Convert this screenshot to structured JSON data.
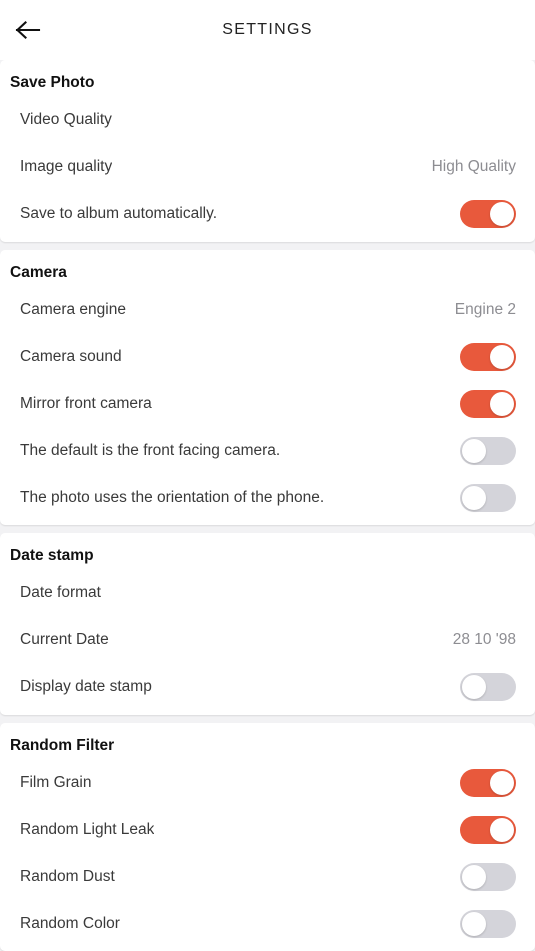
{
  "header": {
    "title": "SETTINGS",
    "back_icon": "arrow-left-icon"
  },
  "theme": {
    "toggle_on_color": "#E8593C",
    "toggle_off_color": "#D4D4DA",
    "page_background": "#F2F2F4",
    "card_background": "#FFFFFF",
    "label_color": "#3A3A3A",
    "value_color": "#8D8D92"
  },
  "sections": [
    {
      "title": "Save Photo",
      "rows": [
        {
          "label": "Video Quality",
          "type": "value",
          "value": ""
        },
        {
          "label": "Image quality",
          "type": "value",
          "value": "High Quality"
        },
        {
          "label": "Save to album automatically.",
          "type": "toggle",
          "on": true
        }
      ]
    },
    {
      "title": "Camera",
      "rows": [
        {
          "label": "Camera engine",
          "type": "value",
          "value": "Engine 2"
        },
        {
          "label": "Camera sound",
          "type": "toggle",
          "on": true
        },
        {
          "label": "Mirror front camera",
          "type": "toggle",
          "on": true
        },
        {
          "label": "The default is the front facing camera.",
          "type": "toggle",
          "on": false
        },
        {
          "label": "The photo uses the orientation of the phone.",
          "type": "toggle",
          "on": false
        }
      ]
    },
    {
      "title": "Date stamp",
      "rows": [
        {
          "label": "Date format",
          "type": "value",
          "value": ""
        },
        {
          "label": "Current Date",
          "type": "value",
          "value": "28 10 '98"
        },
        {
          "label": "Display date stamp",
          "type": "toggle",
          "on": false
        }
      ]
    },
    {
      "title": "Random Filter",
      "rows": [
        {
          "label": "Film Grain",
          "type": "toggle",
          "on": true
        },
        {
          "label": "Random Light Leak",
          "type": "toggle",
          "on": true
        },
        {
          "label": "Random Dust",
          "type": "toggle",
          "on": false
        },
        {
          "label": "Random Color",
          "type": "toggle",
          "on": false
        }
      ]
    }
  ]
}
